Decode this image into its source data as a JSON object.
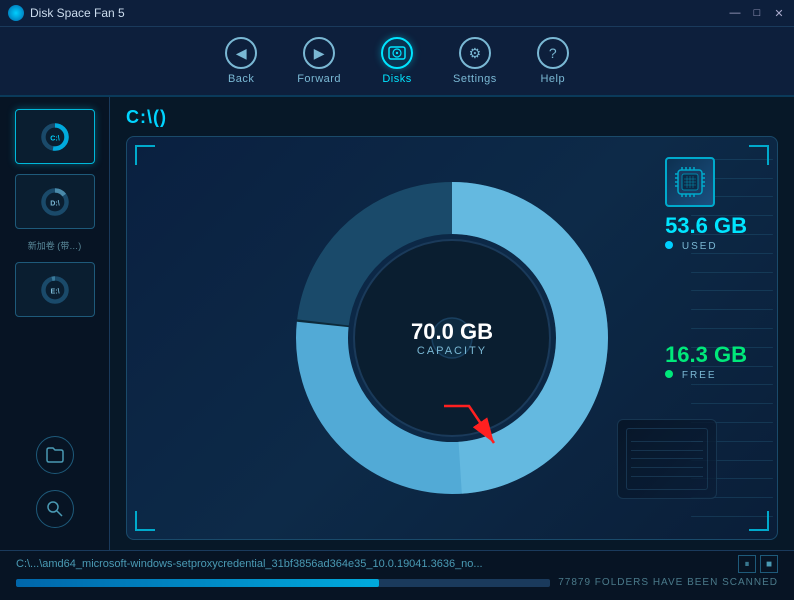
{
  "titleBar": {
    "text": "Disk Space Fan 5",
    "minimize": "—",
    "maximize": "□",
    "close": "✕"
  },
  "toolbar": {
    "items": [
      {
        "id": "back",
        "label": "Back",
        "icon": "◀"
      },
      {
        "id": "forward",
        "label": "Forward",
        "icon": "▶"
      },
      {
        "id": "disks",
        "label": "Disks",
        "icon": "🖴",
        "active": true
      },
      {
        "id": "settings",
        "label": "Settings",
        "icon": "⚙"
      },
      {
        "id": "help",
        "label": "Help",
        "icon": "?"
      }
    ]
  },
  "sidebar": {
    "drives": [
      {
        "id": "c",
        "label": "C:\\",
        "used_pct": 77,
        "active": true
      },
      {
        "id": "d",
        "label": "D:\\",
        "used_pct": 40,
        "active": false
      }
    ],
    "newDriveLabel": "新加卷 (带…)",
    "extraDrive": {
      "id": "e",
      "label": "E:\\",
      "used_pct": 20
    }
  },
  "breadcrumb": "C:\\()",
  "disk": {
    "capacity": "70.0 GB",
    "capacityLabel": "CAPACITY",
    "used": "53.6 GB",
    "usedLabel": "USED",
    "free": "16.3 GB",
    "freeLabel": "FREE",
    "usedColor": "#00cfff",
    "freeColor": "#00e87a",
    "usedPercent": 76.6,
    "freePercent": 23.4
  },
  "statusBar": {
    "filePath": "C:\\...\\amd64_microsoft-windows-setproxycredential_31bf3856ad364e35_10.0.19041.3636_no...",
    "progressPercent": 68,
    "statusText": "77879 FOLDERS HAVE BEEN SCANNED",
    "pauseIcon": "⏸",
    "stopIcon": "■"
  },
  "colors": {
    "accent": "#00d4ff",
    "bg": "#071828",
    "sidebar": "#071424",
    "border": "#1a4a6a"
  }
}
